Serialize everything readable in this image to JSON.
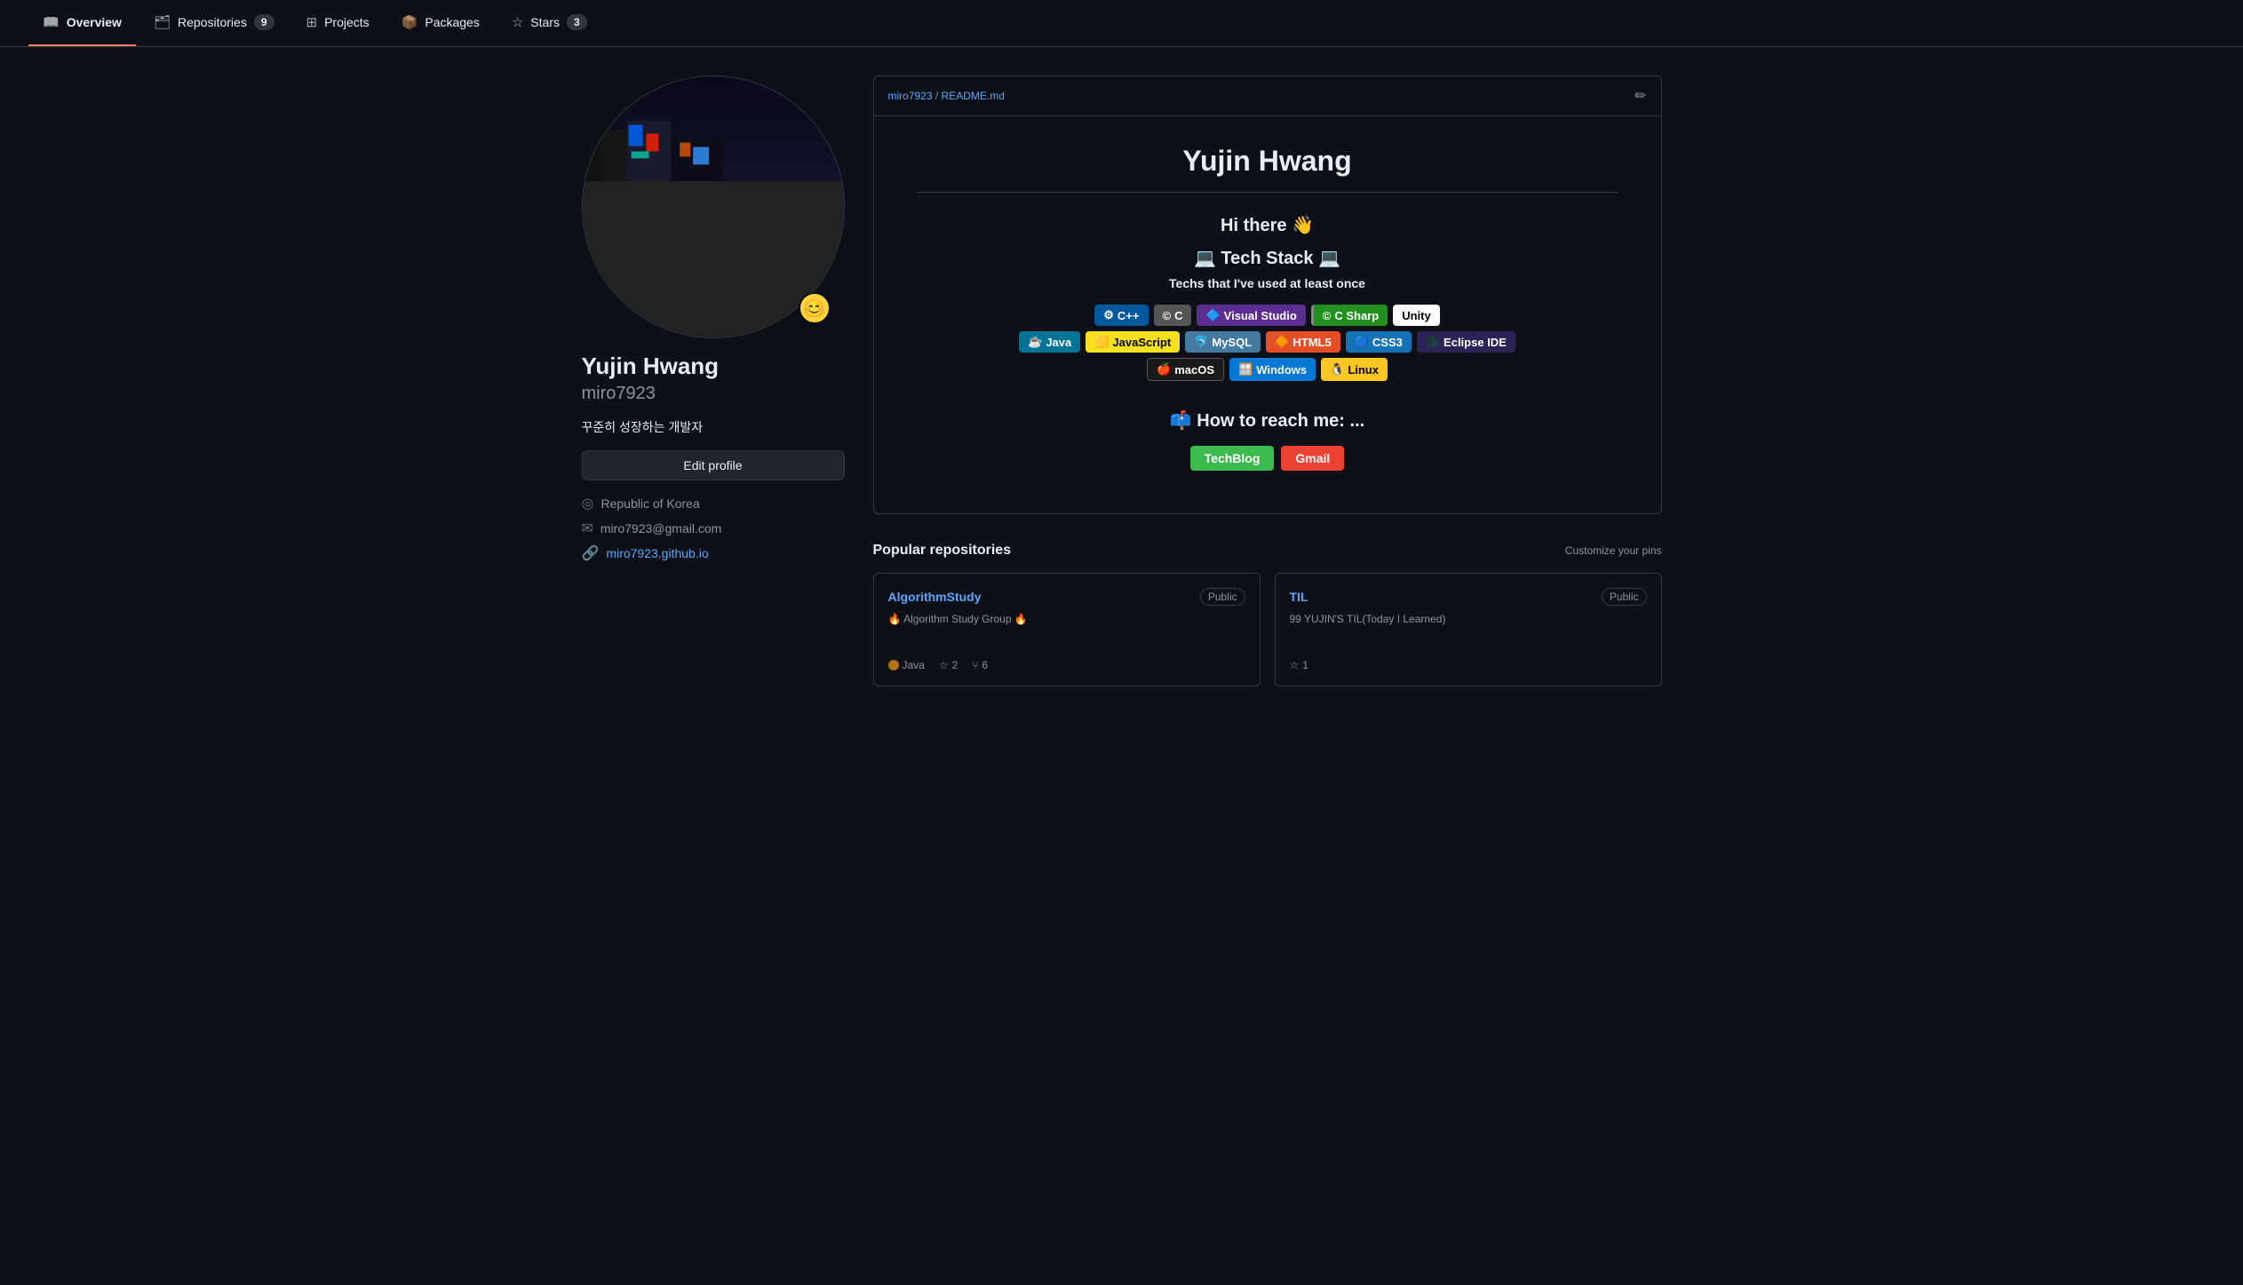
{
  "nav": {
    "tabs": [
      {
        "id": "overview",
        "label": "Overview",
        "icon": "📖",
        "active": true,
        "badge": null
      },
      {
        "id": "repositories",
        "label": "Repositories",
        "icon": "📁",
        "active": false,
        "badge": "9"
      },
      {
        "id": "projects",
        "label": "Projects",
        "icon": "📊",
        "active": false,
        "badge": null
      },
      {
        "id": "packages",
        "label": "Packages",
        "icon": "📦",
        "active": false,
        "badge": null
      },
      {
        "id": "stars",
        "label": "Stars",
        "icon": "⭐",
        "active": false,
        "badge": "3"
      }
    ]
  },
  "sidebar": {
    "name": "Yujin Hwang",
    "username": "miro7923",
    "bio": "꾸준히 성장하는 개발자",
    "edit_button": "Edit profile",
    "location": "Republic of Korea",
    "email": "miro7923@gmail.com",
    "website": "miro7923.github.io",
    "emoji_badge": "😊"
  },
  "readme": {
    "breadcrumb_user": "miro7923",
    "breadcrumb_file": "README.md",
    "title": "Yujin Hwang",
    "greeting": "Hi there 👋",
    "tech_section_title": "💻 Tech Stack 💻",
    "tech_subtitle": "Techs that I've used at least once",
    "badges_row1": [
      {
        "label": "C++",
        "class": "cpp",
        "icon": "⚙"
      },
      {
        "label": "C",
        "class": "c",
        "icon": "©"
      },
      {
        "label": "Visual Studio",
        "class": "visualstudio",
        "icon": "🔷"
      },
      {
        "label": "C Sharp",
        "class": "csharp",
        "icon": "©"
      },
      {
        "label": "Unity",
        "class": "unity",
        "icon": ""
      }
    ],
    "badges_row2": [
      {
        "label": "Java",
        "class": "java",
        "icon": "☕"
      },
      {
        "label": "JavaScript",
        "class": "javascript",
        "icon": "🟨"
      },
      {
        "label": "MySQL",
        "class": "mysql",
        "icon": "🐬"
      },
      {
        "label": "HTML5",
        "class": "html5",
        "icon": "🔶"
      },
      {
        "label": "CSS3",
        "class": "css3",
        "icon": "🔵"
      },
      {
        "label": "Eclipse IDE",
        "class": "eclipse",
        "icon": "🌑"
      }
    ],
    "badges_row3": [
      {
        "label": "macOS",
        "class": "macos",
        "icon": "🍎"
      },
      {
        "label": "Windows",
        "class": "windows",
        "icon": "🪟"
      },
      {
        "label": "Linux",
        "class": "linux",
        "icon": "🐧"
      }
    ],
    "reach_title": "📫 How to reach me: ...",
    "reach_links": [
      {
        "label": "TechBlog",
        "class": "techblog"
      },
      {
        "label": "Gmail",
        "class": "gmail"
      }
    ]
  },
  "popular_repos": {
    "section_title": "Popular repositories",
    "customize_label": "Customize your pins",
    "repos": [
      {
        "name": "AlgorithmStudy",
        "visibility": "Public",
        "description": "🔥 Algorithm Study Group 🔥",
        "language": "Java",
        "lang_class": "java",
        "stars": "2",
        "forks": "6"
      },
      {
        "name": "TIL",
        "visibility": "Public",
        "description": "99 YUJIN'S TIL(Today I Learned)",
        "language": null,
        "lang_class": null,
        "stars": "1",
        "forks": null
      }
    ]
  }
}
